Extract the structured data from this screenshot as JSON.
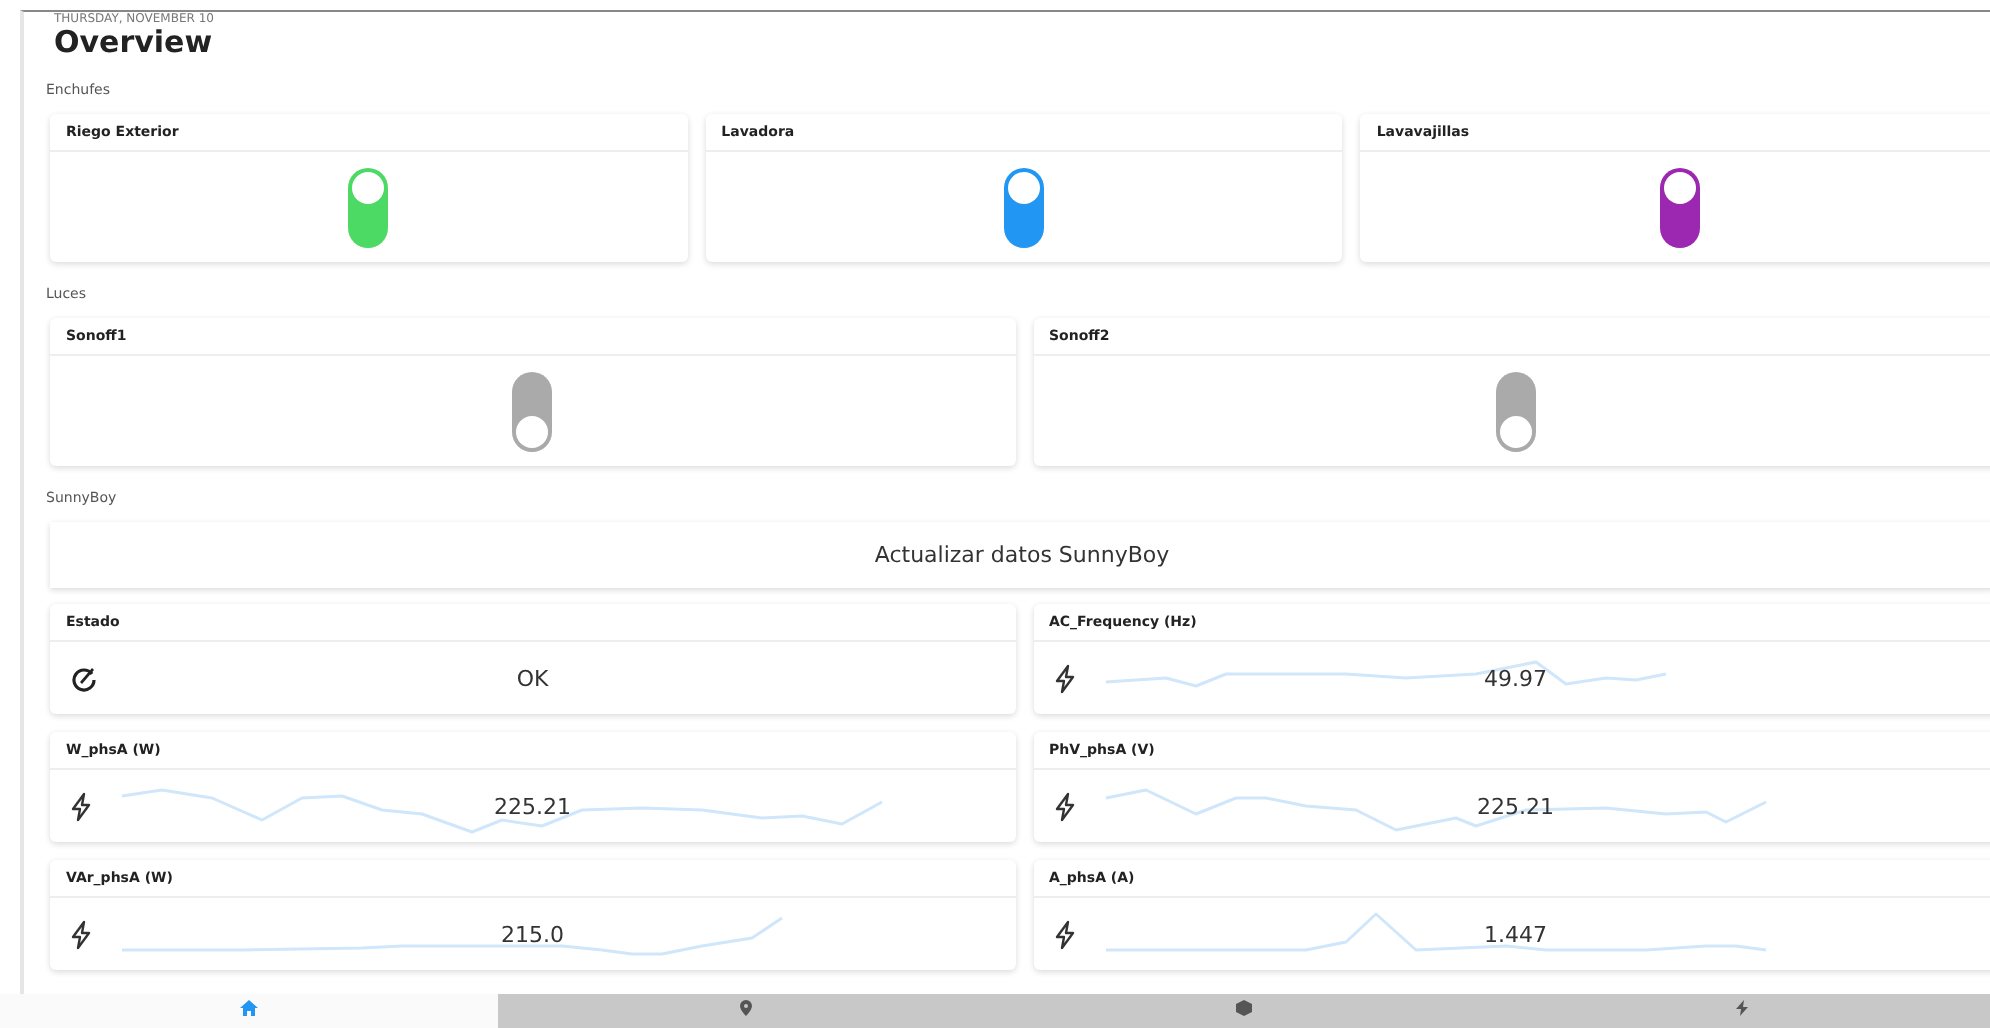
{
  "header": {
    "date": "THURSDAY, NOVEMBER 10",
    "title": "Overview"
  },
  "sections": [
    {
      "title": "Enchufes",
      "switches": [
        {
          "name": "Riego Exterior",
          "on": true,
          "color": "#4cd964"
        },
        {
          "name": "Lavadora",
          "on": true,
          "color": "#2196f3"
        },
        {
          "name": "Lavavajillas",
          "on": true,
          "color": "#9c27b0"
        }
      ]
    },
    {
      "title": "Luces",
      "switches": [
        {
          "name": "Sonoff1",
          "on": false,
          "color": "#aaaaaa"
        },
        {
          "name": "Sonoff2",
          "on": false,
          "color": "#aaaaaa"
        }
      ]
    }
  ],
  "sunnyboy": {
    "title": "SunnyBoy",
    "button": "Actualizar datos SunnyBoy",
    "sensors": [
      {
        "kind": "status",
        "name": "Estado",
        "value": "OK"
      },
      {
        "kind": "power",
        "name": "AC_Frequency (Hz)",
        "value": "49.97"
      },
      {
        "kind": "power",
        "name": "W_phsA (W)",
        "value": "225.21"
      },
      {
        "kind": "power",
        "name": "PhV_phsA (V)",
        "value": "225.21"
      },
      {
        "kind": "power",
        "name": "VAr_phsA (W)",
        "value": "215.0"
      },
      {
        "kind": "power",
        "name": "A_phsA (A)",
        "value": "1.447"
      }
    ]
  },
  "nav": [
    {
      "kind": "home",
      "selected": true
    },
    {
      "kind": "location",
      "selected": false
    },
    {
      "kind": "box",
      "selected": false
    },
    {
      "kind": "bolt",
      "selected": false
    }
  ]
}
